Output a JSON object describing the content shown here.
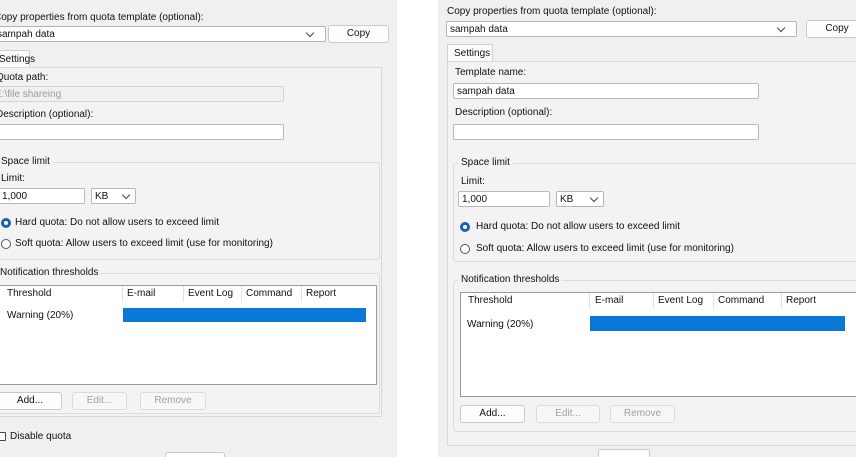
{
  "left": {
    "copy_label": "Copy properties from quota template (optional):",
    "template_value": "sampah data",
    "copy_button": "Copy",
    "tab_settings": "Settings",
    "quota_path_label": "Quota path:",
    "quota_path_value": "E:\\file shareing",
    "description_label": "Description (optional):",
    "description_value": "",
    "space_limit_title": "Space limit",
    "limit_label": "Limit:",
    "limit_value": "1,000",
    "unit": "KB",
    "hard_quota": "Hard quota: Do not allow users to exceed limit",
    "soft_quota": "Soft quota: Allow users to exceed limit (use for monitoring)",
    "notif_title": "Notification thresholds",
    "columns": [
      "Threshold",
      "E-mail",
      "Event Log",
      "Command",
      "Report"
    ],
    "rows": [
      "Warning (20%)"
    ],
    "add": "Add...",
    "edit": "Edit...",
    "remove": "Remove",
    "disable_quota": "Disable quota"
  },
  "right": {
    "copy_label": "Copy properties from quota template (optional):",
    "template_value": "sampah data",
    "copy_button": "Copy",
    "tab_settings": "Settings",
    "template_name_label": "Template name:",
    "template_name_value": "sampah data",
    "description_label": "Description (optional):",
    "description_value": "",
    "space_limit_title": "Space limit",
    "limit_label": "Limit:",
    "limit_value": "1,000",
    "unit": "KB",
    "hard_quota": "Hard quota: Do not allow users to exceed limit",
    "soft_quota": "Soft quota: Allow users to exceed limit (use for monitoring)",
    "notif_title": "Notification thresholds",
    "columns": [
      "Threshold",
      "E-mail",
      "Event Log",
      "Command",
      "Report"
    ],
    "rows": [
      "Warning (20%)"
    ],
    "add": "Add...",
    "edit": "Edit...",
    "remove": "Remove"
  },
  "colors": {
    "selection": "#0a78d7",
    "radio_selected": "#1a5fb4"
  }
}
